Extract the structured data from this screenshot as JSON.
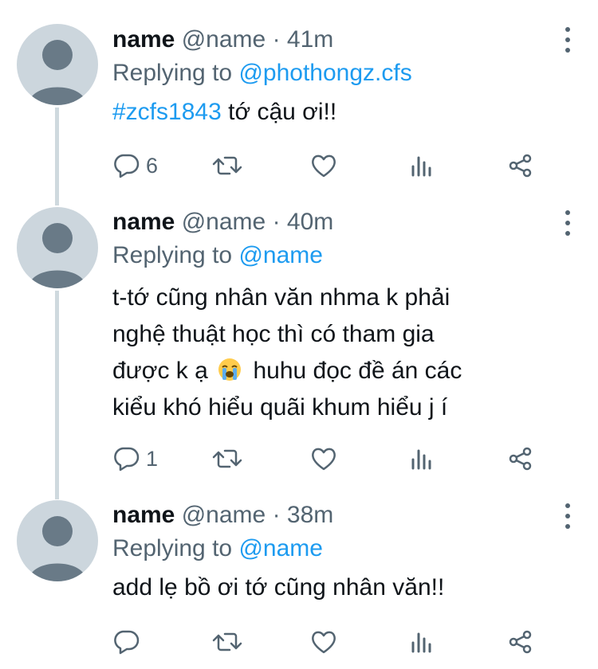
{
  "colors": {
    "accent": "#1d9bf0",
    "muted": "#536471",
    "text": "#0f1419",
    "avatar_bg": "#ccd6dd",
    "avatar_fg": "#697a87",
    "thread_line": "#cfd9de"
  },
  "tweets": [
    {
      "name": "name",
      "handle": "@name",
      "separator": "·",
      "time": "41m",
      "replying_label": "Replying to",
      "replying_to": "@phothongz.cfs",
      "hashtag": "#zcfs1843",
      "text": "tớ cậu ơi!!",
      "reply_count": "6"
    },
    {
      "name": "name",
      "handle": "@name",
      "separator": "·",
      "time": "40m",
      "replying_label": "Replying to",
      "replying_to": "@name",
      "text_line1": "t-tớ cũng nhân văn nhma k phải",
      "text_line2": "nghệ thuật học thì có tham gia",
      "text_line3a": "được k ạ",
      "emoji": "loudly-crying-face-emoji",
      "text_line3b": "huhu đọc đề án các",
      "text_line4": "kiểu khó hiểu quãi khum hiểu j í",
      "reply_count": "1"
    },
    {
      "name": "name",
      "handle": "@name",
      "separator": "·",
      "time": "38m",
      "replying_label": "Replying to",
      "replying_to": "@name",
      "text": "add lẹ bồ ơi tớ cũng nhân văn!!",
      "reply_count": ""
    }
  ],
  "icons": [
    "reply-icon",
    "retweet-icon",
    "like-icon",
    "views-icon",
    "share-icon",
    "more-icon",
    "default-avatar-icon"
  ]
}
